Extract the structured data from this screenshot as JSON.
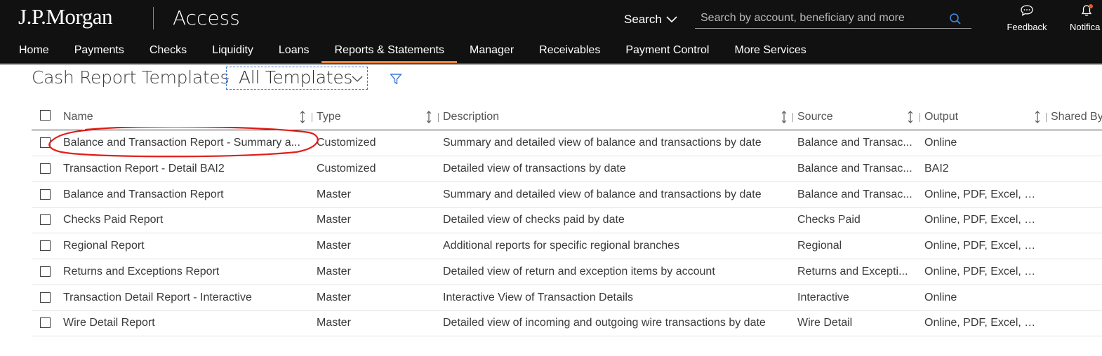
{
  "header": {
    "brand": "J.P.Morgan",
    "product": "Access",
    "search_label": "Search",
    "search_placeholder": "Search by account, beneficiary and more",
    "feedback_label": "Feedback",
    "notifications_label": "Notifica",
    "search_icon": "search-icon",
    "feedback_icon": "chat-bubble-icon",
    "notifications_icon": "bell-icon"
  },
  "nav": {
    "items": [
      "Home",
      "Payments",
      "Checks",
      "Liquidity",
      "Loans",
      "Reports & Statements",
      "Manager",
      "Receivables",
      "Payment Control",
      "More Services"
    ],
    "active": "Reports & Statements"
  },
  "page": {
    "title": "Cash Report Templates",
    "separator": "-",
    "template_filter": "All Templates"
  },
  "table": {
    "columns": [
      "Name",
      "Type",
      "Description",
      "Source",
      "Output",
      "Shared By"
    ],
    "rows": [
      {
        "name": "Balance and Transaction Report - Summary a...",
        "type": "Customized",
        "description": "Summary and detailed view of balance and transactions by date",
        "source": "Balance and Transac...",
        "output": "Online"
      },
      {
        "name": "Transaction Report - Detail BAI2",
        "type": "Customized",
        "description": "Detailed view of transactions by date",
        "source": "Balance and Transac...",
        "output": "BAI2"
      },
      {
        "name": "Balance and Transaction Report",
        "type": "Master",
        "description": "Summary and detailed view of balance and transactions by date",
        "source": "Balance and Transac...",
        "output": "Online, PDF, Excel, C..."
      },
      {
        "name": "Checks Paid Report",
        "type": "Master",
        "description": "Detailed view of checks paid by date",
        "source": "Checks Paid",
        "output": "Online, PDF, Excel, C..."
      },
      {
        "name": "Regional Report",
        "type": "Master",
        "description": "Additional reports for specific regional branches",
        "source": "Regional",
        "output": "Online, PDF, Excel, C..."
      },
      {
        "name": "Returns and Exceptions Report",
        "type": "Master",
        "description": "Detailed view of return and exception items by account",
        "source": "Returns and Excepti...",
        "output": "Online, PDF, Excel, C..."
      },
      {
        "name": "Transaction Detail Report - Interactive",
        "type": "Master",
        "description": "Interactive View of Transaction Details",
        "source": "Interactive",
        "output": "Online"
      },
      {
        "name": "Wire Detail Report",
        "type": "Master",
        "description": "Detailed view of incoming and outgoing wire transactions by date",
        "source": "Wire Detail",
        "output": "Online, PDF, Excel, C..."
      }
    ]
  },
  "colors": {
    "header_bg": "#111111",
    "active_tab_underline": "#e8823a",
    "accent_blue": "#3a7ad8",
    "annotation_red": "#e0201b"
  }
}
